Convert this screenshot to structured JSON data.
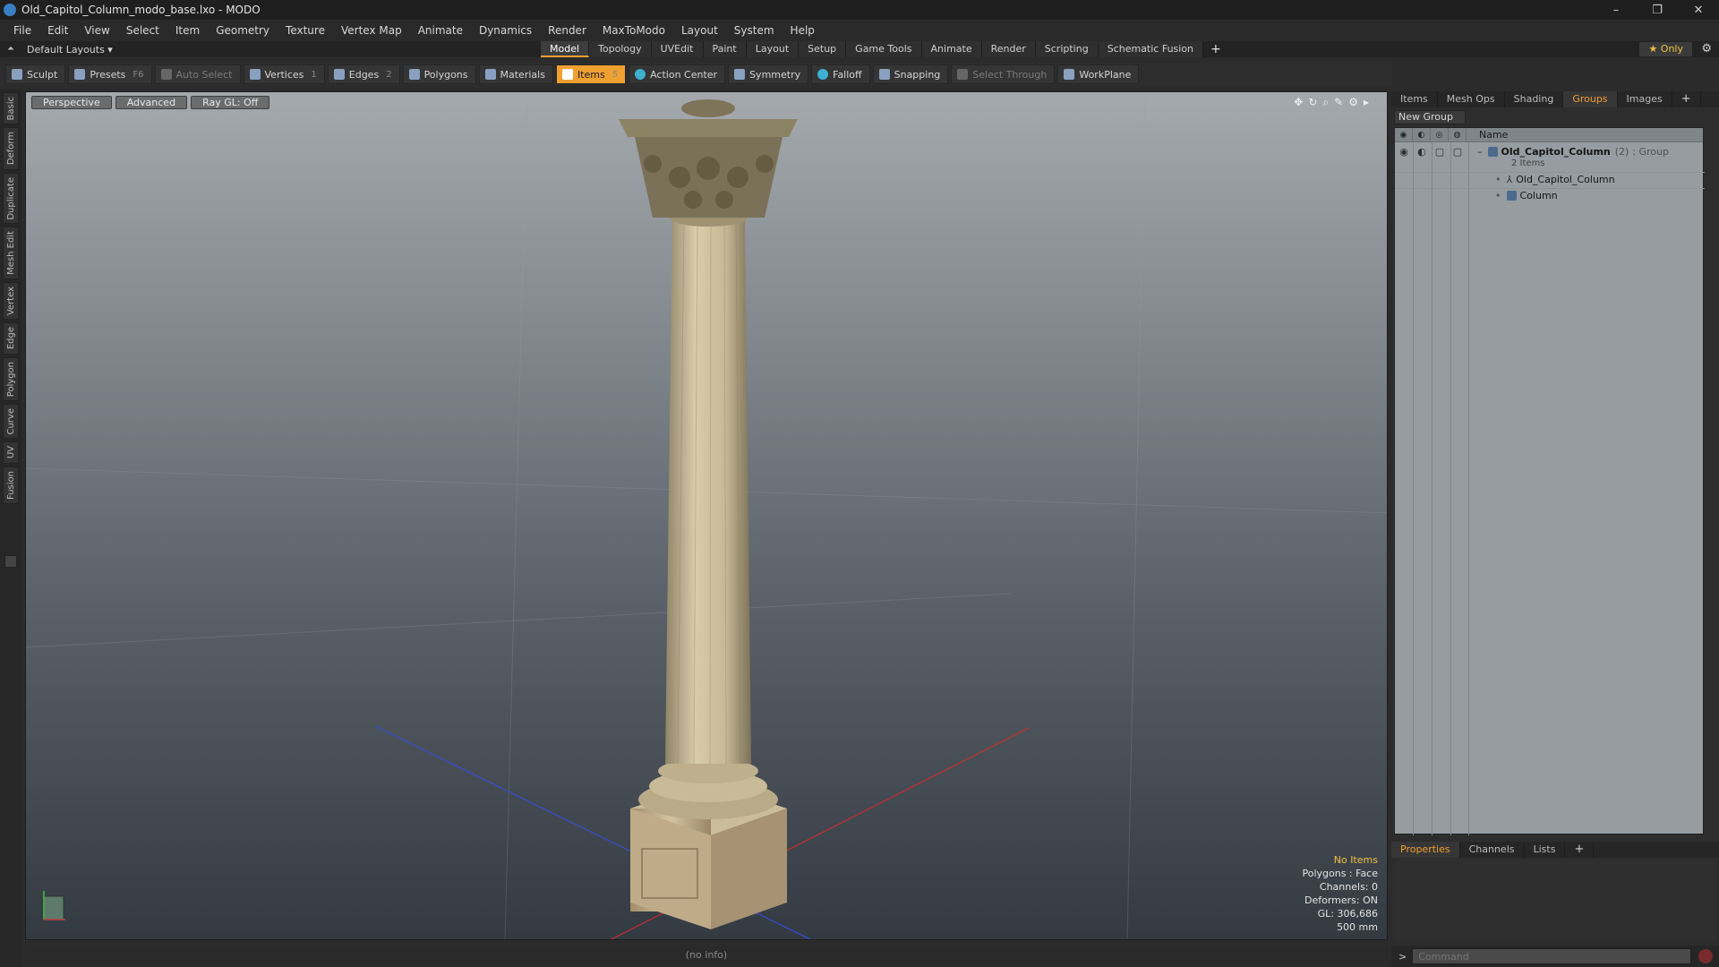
{
  "window": {
    "title": "Old_Capitol_Column_modo_base.lxo - MODO",
    "minimize": "–",
    "maximize": "❐",
    "close": "✕"
  },
  "menus": [
    "File",
    "Edit",
    "View",
    "Select",
    "Item",
    "Geometry",
    "Texture",
    "Vertex Map",
    "Animate",
    "Dynamics",
    "Render",
    "MaxToModo",
    "Layout",
    "System",
    "Help"
  ],
  "layout_selector": "Default Layouts ▾",
  "tabs": [
    "Model",
    "Topology",
    "UVEdit",
    "Paint",
    "Layout",
    "Setup",
    "Game Tools",
    "Animate",
    "Render",
    "Scripting",
    "Schematic Fusion"
  ],
  "active_tab": "Model",
  "tab_add": "+",
  "only_label": "★ Only",
  "gear": "⚙",
  "toolbar": {
    "sculpt": "Sculpt",
    "presets": "Presets",
    "presets_key": "F6",
    "auto_select": "Auto Select",
    "vertices": "Vertices",
    "vertices_key": "1",
    "edges": "Edges",
    "edges_key": "2",
    "polygons": "Polygons",
    "materials": "Materials",
    "items": "Items",
    "items_key": "5",
    "action_center": "Action Center",
    "symmetry": "Symmetry",
    "falloff": "Falloff",
    "snapping": "Snapping",
    "select_through": "Select Through",
    "workplane": "WorkPlane"
  },
  "left_tabs": [
    "Basic",
    "Deform",
    "Duplicate",
    "Mesh Edit",
    "Vertex",
    "Edge",
    "Polygon",
    "Curve",
    "UV",
    "Fusion"
  ],
  "viewport": {
    "perspective": "Perspective",
    "advanced": "Advanced",
    "raygl": "Ray GL: Off",
    "icons": [
      "✥",
      "↻",
      "⌕",
      "✎",
      "⚙",
      "▸"
    ],
    "info": {
      "no_items": "No Items",
      "polygons": "Polygons : Face",
      "channels": "Channels: 0",
      "deformers": "Deformers: ON",
      "gl": "GL: 306,686",
      "scale": "500 mm"
    }
  },
  "status": "(no info)",
  "right_panel": {
    "tabs": [
      "Items",
      "Mesh Ops",
      "Shading",
      "Groups",
      "Images"
    ],
    "active_tab": "Groups",
    "add": "+",
    "new_group": "New Group",
    "name_header": "Name",
    "group": {
      "name": "Old_Capitol_Column",
      "count": "(2)",
      "type": ": Group",
      "sub": "2 Items"
    },
    "children": [
      "Old_Capitol_Column",
      "Column"
    ],
    "bottom_tabs": [
      "Properties",
      "Channels",
      "Lists"
    ],
    "bottom_active": "Properties",
    "command_prompt": ">",
    "command_placeholder": "Command"
  }
}
